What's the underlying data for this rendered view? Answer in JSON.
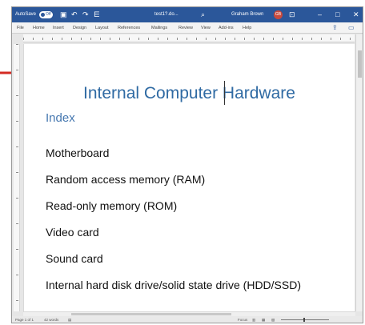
{
  "titlebar": {
    "autosave_label": "AutoSave",
    "autosave_state": "Off",
    "doc_name": "test1?.do...",
    "user_name": "Graham Brown",
    "user_initials": "GB",
    "undo_symbol": "↶",
    "redo_symbol": "↷",
    "search_symbol": "⌕",
    "minimize_symbol": "–",
    "maximize_symbol": "□",
    "close_symbol": "✕"
  },
  "ribbon": {
    "tabs": [
      "File",
      "Home",
      "Insert",
      "Design",
      "Layout",
      "References",
      "Mailings",
      "Review",
      "View",
      "Add-ins",
      "Help"
    ],
    "share_symbol": "⇪"
  },
  "document": {
    "title": "Internal Computer Hardware",
    "subtitle": "Index",
    "items": [
      "Motherboard",
      "Random access memory (RAM)",
      "Read-only memory (ROM)",
      "Video card",
      "Sound card",
      "Internal hard disk drive/solid state drive (HDD/SSD)"
    ]
  },
  "statusbar": {
    "page_info": "Page 1 of 1",
    "words": "42 words",
    "focus": "Focus"
  },
  "colors": {
    "titlebar": "#2b579a",
    "heading": "#2f6aa3",
    "annotation_arrow": "#d42a23"
  },
  "icons": {
    "annotation": "red-arrow-icon"
  }
}
